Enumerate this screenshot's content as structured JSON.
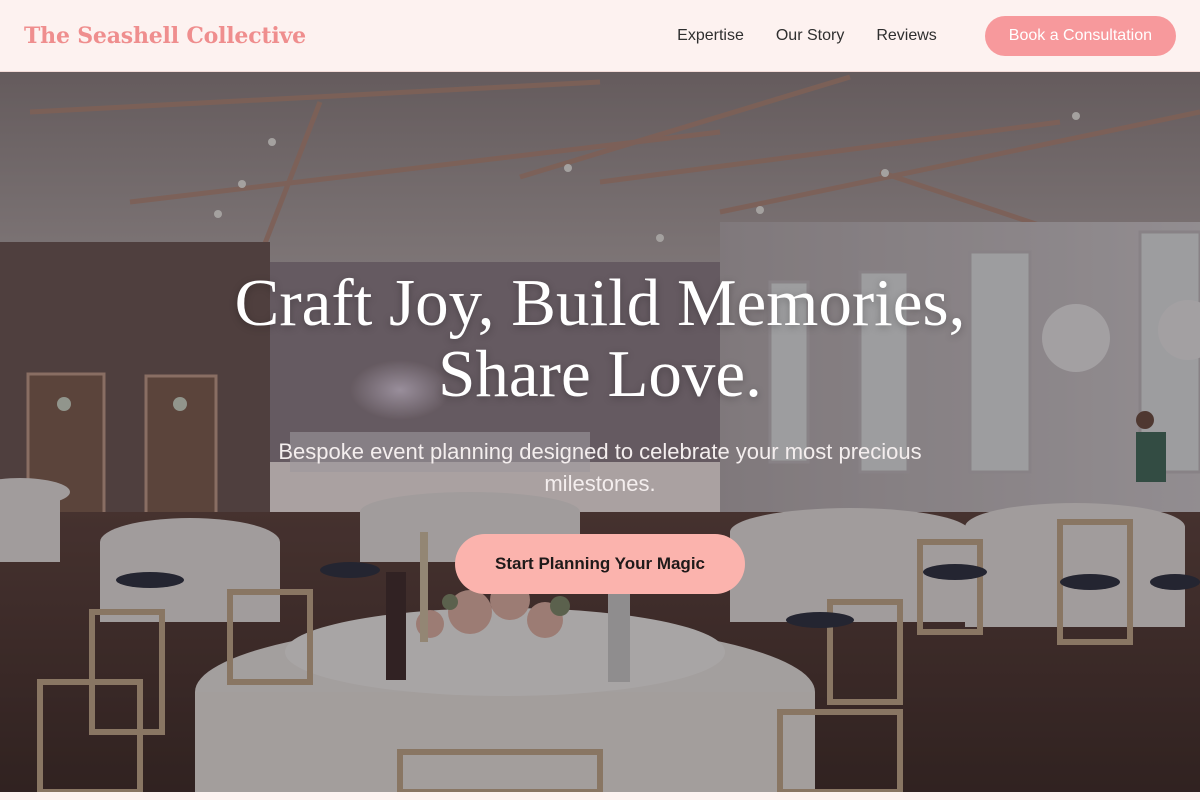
{
  "nav": {
    "brand": "The Seashell Collective",
    "links": [
      "Expertise",
      "Our Story",
      "Reviews"
    ],
    "cta_label": "Book a Consultation"
  },
  "hero": {
    "title": "Craft Joy, Build Memories, Share Love.",
    "subtitle": "Bespoke event planning designed to celebrate your most precious milestones.",
    "cta_label": "Start Planning Your Magic"
  },
  "colors": {
    "brand": "#ef8e8e",
    "nav_background": "#fdf2f0",
    "nav_cta": "#f7999c",
    "hero_cta": "#fbb3ad"
  }
}
